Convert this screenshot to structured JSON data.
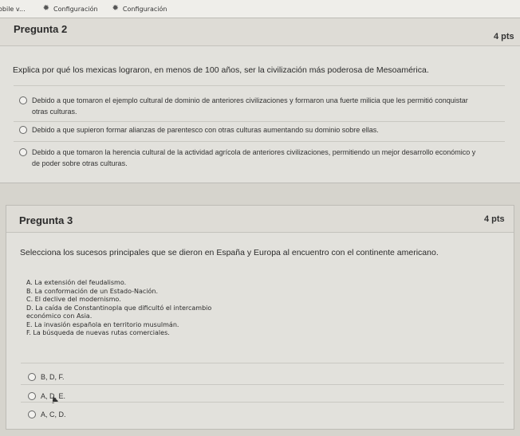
{
  "bookmarks": [
    {
      "label": "obile v...",
      "icon": ""
    },
    {
      "label": "Configuración",
      "icon": "gear-icon"
    },
    {
      "label": "Configuración",
      "icon": "gear-icon"
    }
  ],
  "q2": {
    "title": "Pregunta 2",
    "points": "4 pts",
    "question": "Explica por qué los mexicas lograron, en menos de 100 años, ser la civilización más poderosa de Mesoamérica.",
    "options": [
      {
        "line1": "Debido a que tomaron el ejemplo cultural de dominio de anteriores civilizaciones y formaron una fuerte milicia que les permitió conquistar",
        "line2": "otras culturas."
      },
      {
        "line1": "Debido a que supieron formar alianzas de parentesco con otras culturas aumentando su dominio sobre ellas.",
        "line2": ""
      },
      {
        "line1": "Debido a que tomaron la herencia cultural de la actividad agrícola de anteriores civilizaciones, permitiendo un mejor desarrollo económico y",
        "line2": "de poder sobre otras culturas."
      }
    ]
  },
  "q3": {
    "title": "Pregunta 3",
    "points": "4 pts",
    "question": "Selecciona los sucesos principales que se dieron en España y Europa al encuentro con el continente americano.",
    "list": [
      "A. La extensión del feudalismo.",
      "B. La conformación de un Estado-Nación.",
      "C. El declive del modernismo.",
      "D. La caída de Constantinopla que dificultó el intercambio",
      "económico con Asia.",
      "E. La invasión española en territorio musulmán.",
      "F. La búsqueda de nuevas rutas comerciales."
    ],
    "options": [
      "B, D, F.",
      "A, D, E.",
      "A, C, D."
    ]
  }
}
